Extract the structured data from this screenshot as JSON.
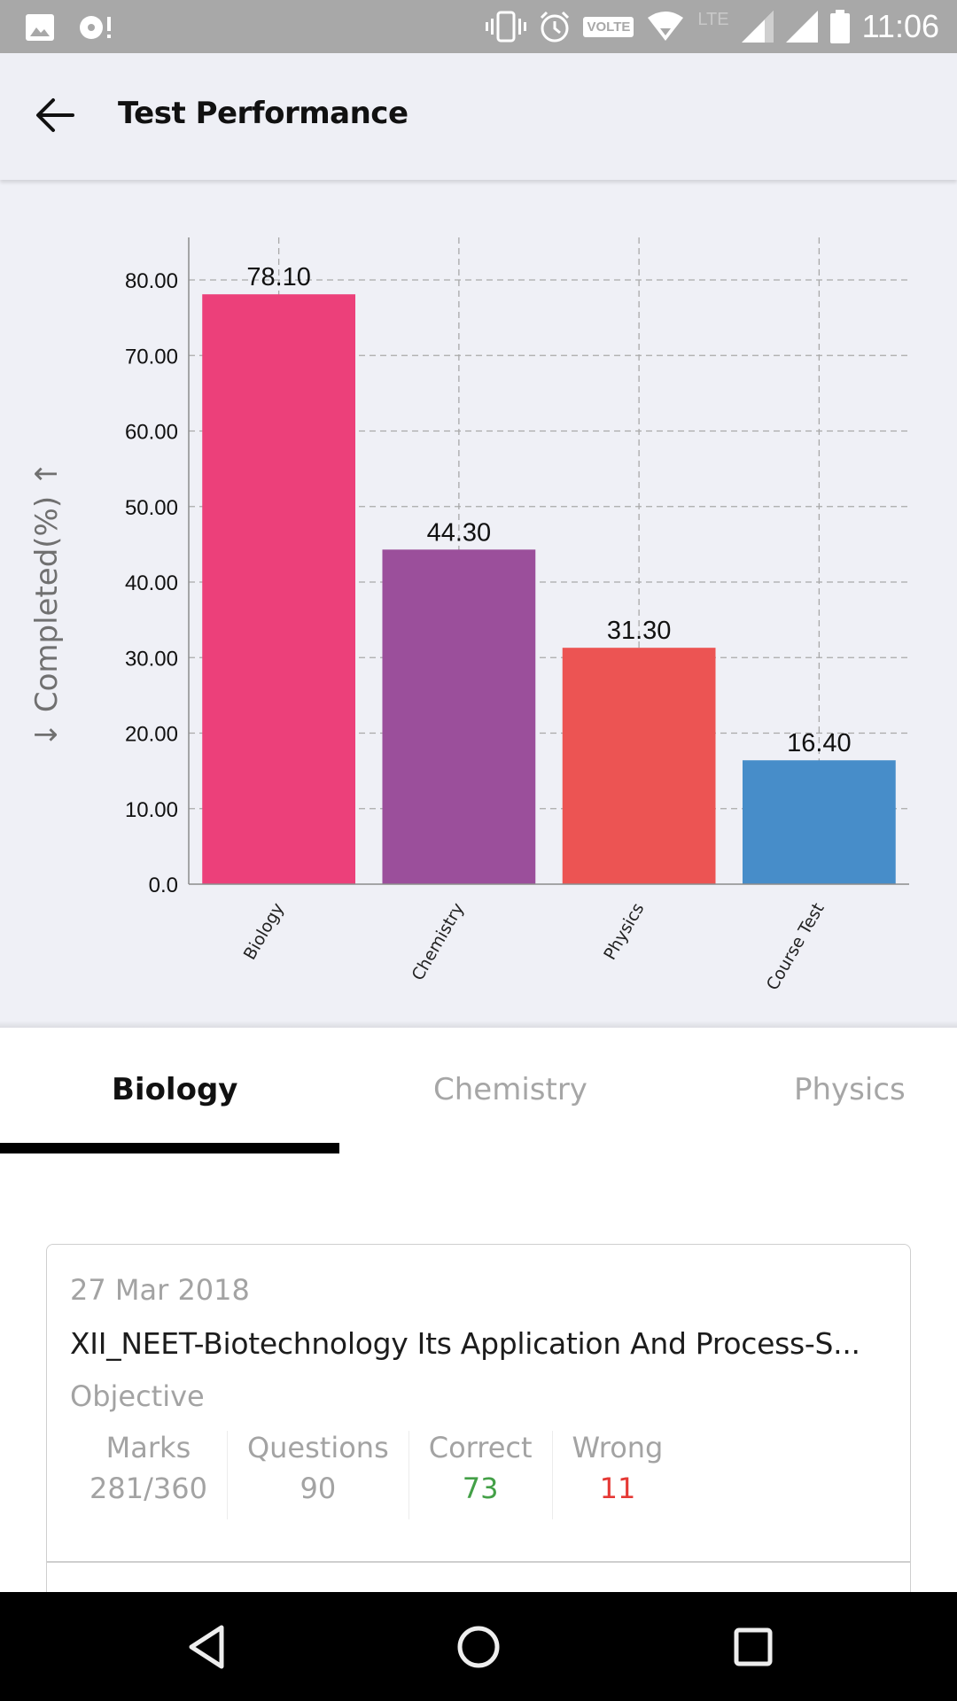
{
  "status_bar": {
    "time": "11:06",
    "volte_label": "VOLTE",
    "network_label": "LTE",
    "icons": [
      "image-icon",
      "sync-alert-icon",
      "vibrate-icon",
      "alarm-icon",
      "volte-icon",
      "wifi-icon",
      "signal-icon",
      "signal-icon",
      "battery-icon"
    ]
  },
  "app_bar": {
    "title": "Test Performance",
    "back_icon": "arrow-left-icon"
  },
  "colors": {
    "biology": "#ec407a",
    "chemistry": "#9b4f9b",
    "physics": "#ec5453",
    "course_test": "#478dc9",
    "correct": "#43a047",
    "wrong": "#e53935"
  },
  "chart_data": {
    "type": "bar",
    "title": "",
    "xlabel": "",
    "ylabel": "↓ Completed(%) ↑",
    "categories": [
      "Biology",
      "Chemistry",
      "Physics",
      "Course Test"
    ],
    "values": [
      78.1,
      44.3,
      31.3,
      16.4
    ],
    "value_labels": [
      "78.10",
      "44.30",
      "31.30",
      "16.40"
    ],
    "bar_colors": [
      "#ec407a",
      "#9b4f9b",
      "#ec5453",
      "#478dc9"
    ],
    "yticks": [
      0,
      10,
      20,
      30,
      40,
      50,
      60,
      70,
      80
    ],
    "ytick_labels": [
      "0.0",
      "10.00",
      "20.00",
      "30.00",
      "40.00",
      "50.00",
      "60.00",
      "70.00",
      "80.00"
    ],
    "ylim": [
      0,
      87
    ],
    "grid": true,
    "grid_style": "dashed",
    "xtick_rotation": "-60deg",
    "legend": "none"
  },
  "tabs": [
    {
      "label": "Biology",
      "active": true
    },
    {
      "label": "Chemistry",
      "active": false
    },
    {
      "label": "Physics",
      "active": false
    }
  ],
  "test_card": {
    "date": "27 Mar 2018",
    "title": "XII_NEET-Biotechnology Its Application And Process-S...",
    "type": "Objective",
    "stats": [
      {
        "label": "Marks",
        "value": "281/360"
      },
      {
        "label": "Questions",
        "value": "90"
      },
      {
        "label": "Correct",
        "value": "73"
      },
      {
        "label": "Wrong",
        "value": "11"
      }
    ]
  },
  "nav_bar": {
    "buttons": [
      "back-triangle-icon",
      "home-circle-icon",
      "recents-square-icon"
    ]
  }
}
